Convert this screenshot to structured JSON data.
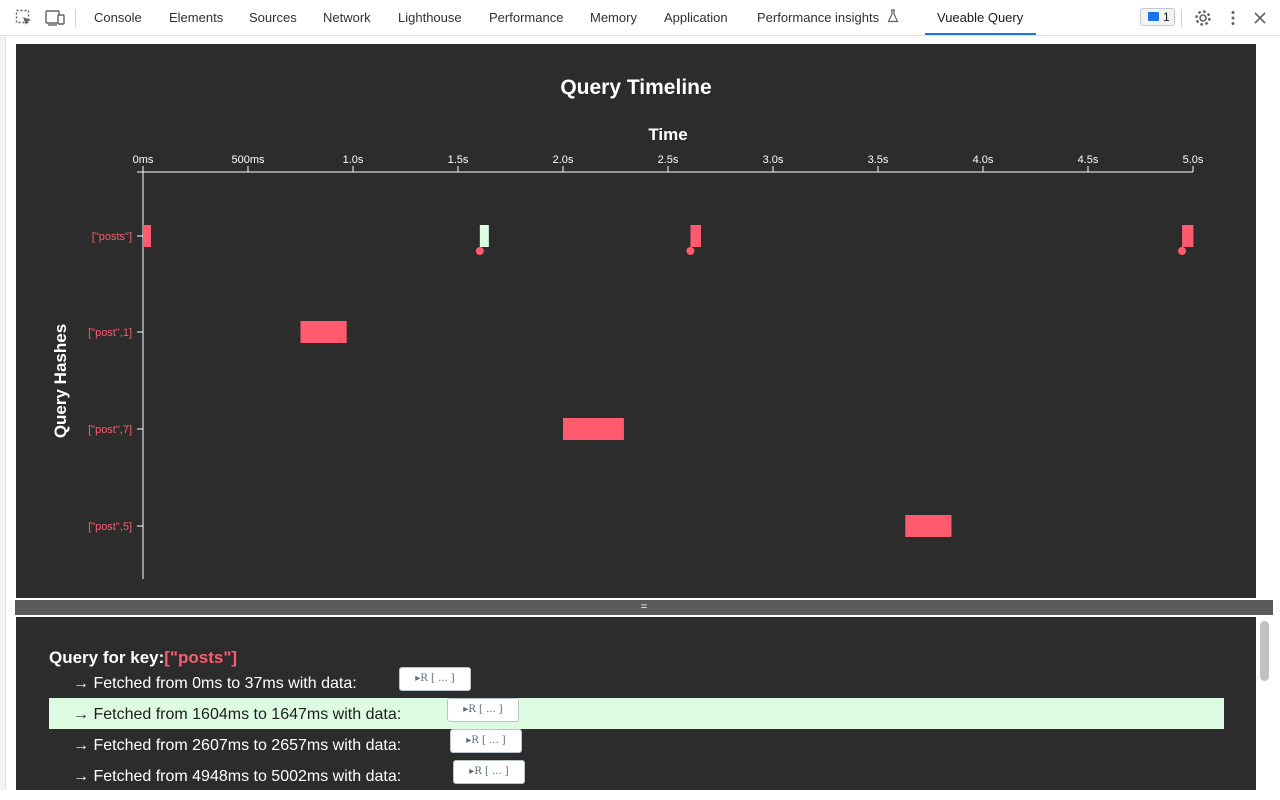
{
  "devtools": {
    "tabs": [
      {
        "label": "Console"
      },
      {
        "label": "Elements"
      },
      {
        "label": "Sources"
      },
      {
        "label": "Network"
      },
      {
        "label": "Lighthouse"
      },
      {
        "label": "Performance"
      },
      {
        "label": "Memory"
      },
      {
        "label": "Application"
      },
      {
        "label": "Performance insights"
      },
      {
        "label": "Vueable Query"
      }
    ],
    "active_tab": "Vueable Query",
    "issues_count": "1",
    "icons": [
      "inspect-element-icon",
      "device-toolbar-icon",
      "flask-icon",
      "message-icon",
      "gear-icon",
      "more-vertical-icon",
      "close-icon"
    ],
    "accent_color": "#1a73e8"
  },
  "chart_data": {
    "type": "timeline",
    "title": "Query Timeline",
    "xlabel": "Time",
    "ylabel": "Query Hashes",
    "xlim": [
      0,
      5000
    ],
    "x_ticks": [
      {
        "value": 0,
        "label": "0ms"
      },
      {
        "value": 500,
        "label": "500ms"
      },
      {
        "value": 1000,
        "label": "1.0s"
      },
      {
        "value": 1500,
        "label": "1.5s"
      },
      {
        "value": 2000,
        "label": "2.0s"
      },
      {
        "value": 2500,
        "label": "2.5s"
      },
      {
        "value": 3000,
        "label": "3.0s"
      },
      {
        "value": 3500,
        "label": "3.5s"
      },
      {
        "value": 4000,
        "label": "4.0s"
      },
      {
        "value": 4500,
        "label": "4.5s"
      },
      {
        "value": 5000,
        "label": "5.0s"
      }
    ],
    "categories": [
      "[\"posts\"]",
      "[\"post\",1]",
      "[\"post\",7]",
      "[\"post\",5]"
    ],
    "series": [
      {
        "category": "[\"posts\"]",
        "start": 0,
        "end": 37,
        "selected": false,
        "marker": false
      },
      {
        "category": "[\"posts\"]",
        "start": 1604,
        "end": 1647,
        "selected": true,
        "marker": true
      },
      {
        "category": "[\"posts\"]",
        "start": 2607,
        "end": 2657,
        "selected": false,
        "marker": true
      },
      {
        "category": "[\"posts\"]",
        "start": 4948,
        "end": 5002,
        "selected": false,
        "marker": true
      },
      {
        "category": "[\"post\",1]",
        "start": 750,
        "end": 970,
        "selected": false,
        "marker": false
      },
      {
        "category": "[\"post\",7]",
        "start": 2000,
        "end": 2290,
        "selected": false,
        "marker": false
      },
      {
        "category": "[\"post\",5]",
        "start": 3630,
        "end": 3850,
        "selected": false,
        "marker": false
      }
    ],
    "colors": {
      "bar": "#ff5a6e",
      "selected": "#dcfbe0",
      "background": "#2c2c2c",
      "text": "#ffffff",
      "label": "#ff5a6e"
    },
    "grid": false
  },
  "detail": {
    "title_prefix": "Query for key:",
    "key": "[\"posts\"]",
    "fetches": [
      {
        "text": "→ Fetched from 0ms to 37ms with data:",
        "chip": "▸R [ ... ]",
        "highlight": false
      },
      {
        "text": "→ Fetched from 1604ms to 1647ms with data:",
        "chip": "▸R [ ... ]",
        "highlight": true
      },
      {
        "text": "→ Fetched from 2607ms to 2657ms with data:",
        "chip": "▸R [ ... ]",
        "highlight": false
      },
      {
        "text": "→ Fetched from 4948ms to 5002ms with data:",
        "chip": "▸R [ ... ]",
        "highlight": false
      }
    ]
  },
  "divider": {
    "label": "="
  }
}
